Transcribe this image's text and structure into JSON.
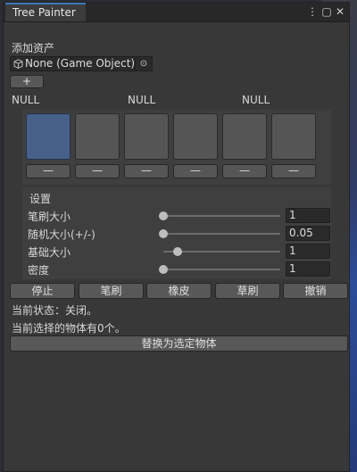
{
  "window": {
    "title": "Tree Painter",
    "menu_icon": "⋮",
    "maximize_icon": "▢",
    "close_icon": "✕"
  },
  "asset": {
    "section_label": "添加资产",
    "object_field_value": "None (Game Object)",
    "picker_icon": "⊙",
    "add_button_label": "+"
  },
  "slots": {
    "null_labels": [
      "NULL",
      "NULL",
      "NULL"
    ],
    "items": [
      {
        "selected": true,
        "button_label": "—"
      },
      {
        "selected": false,
        "button_label": "—"
      },
      {
        "selected": false,
        "button_label": "—"
      },
      {
        "selected": false,
        "button_label": "—"
      },
      {
        "selected": false,
        "button_label": "—"
      },
      {
        "selected": false,
        "button_label": "—"
      }
    ]
  },
  "settings": {
    "title": "设置",
    "rows": [
      {
        "label": "笔刷大小",
        "value": "1",
        "slider_fraction": 0.0
      },
      {
        "label": "随机大小(+/-)",
        "value": "0.05",
        "slider_fraction": 0.0
      },
      {
        "label": "基础大小",
        "value": "1",
        "slider_fraction": 0.12
      },
      {
        "label": "密度",
        "value": "1",
        "slider_fraction": 0.0
      }
    ]
  },
  "toolbar": {
    "buttons": [
      "停止",
      "笔刷",
      "橡皮",
      "草刷",
      "撤销"
    ]
  },
  "status": {
    "state_line": "当前状态：关闭。",
    "selection_line": "当前选择的物体有0个。"
  },
  "replace_button_label": "替换为选定物体",
  "colors": {
    "accent_tab": "#3a79bb",
    "selected_slot": "#46608a",
    "panel": "#383838"
  }
}
